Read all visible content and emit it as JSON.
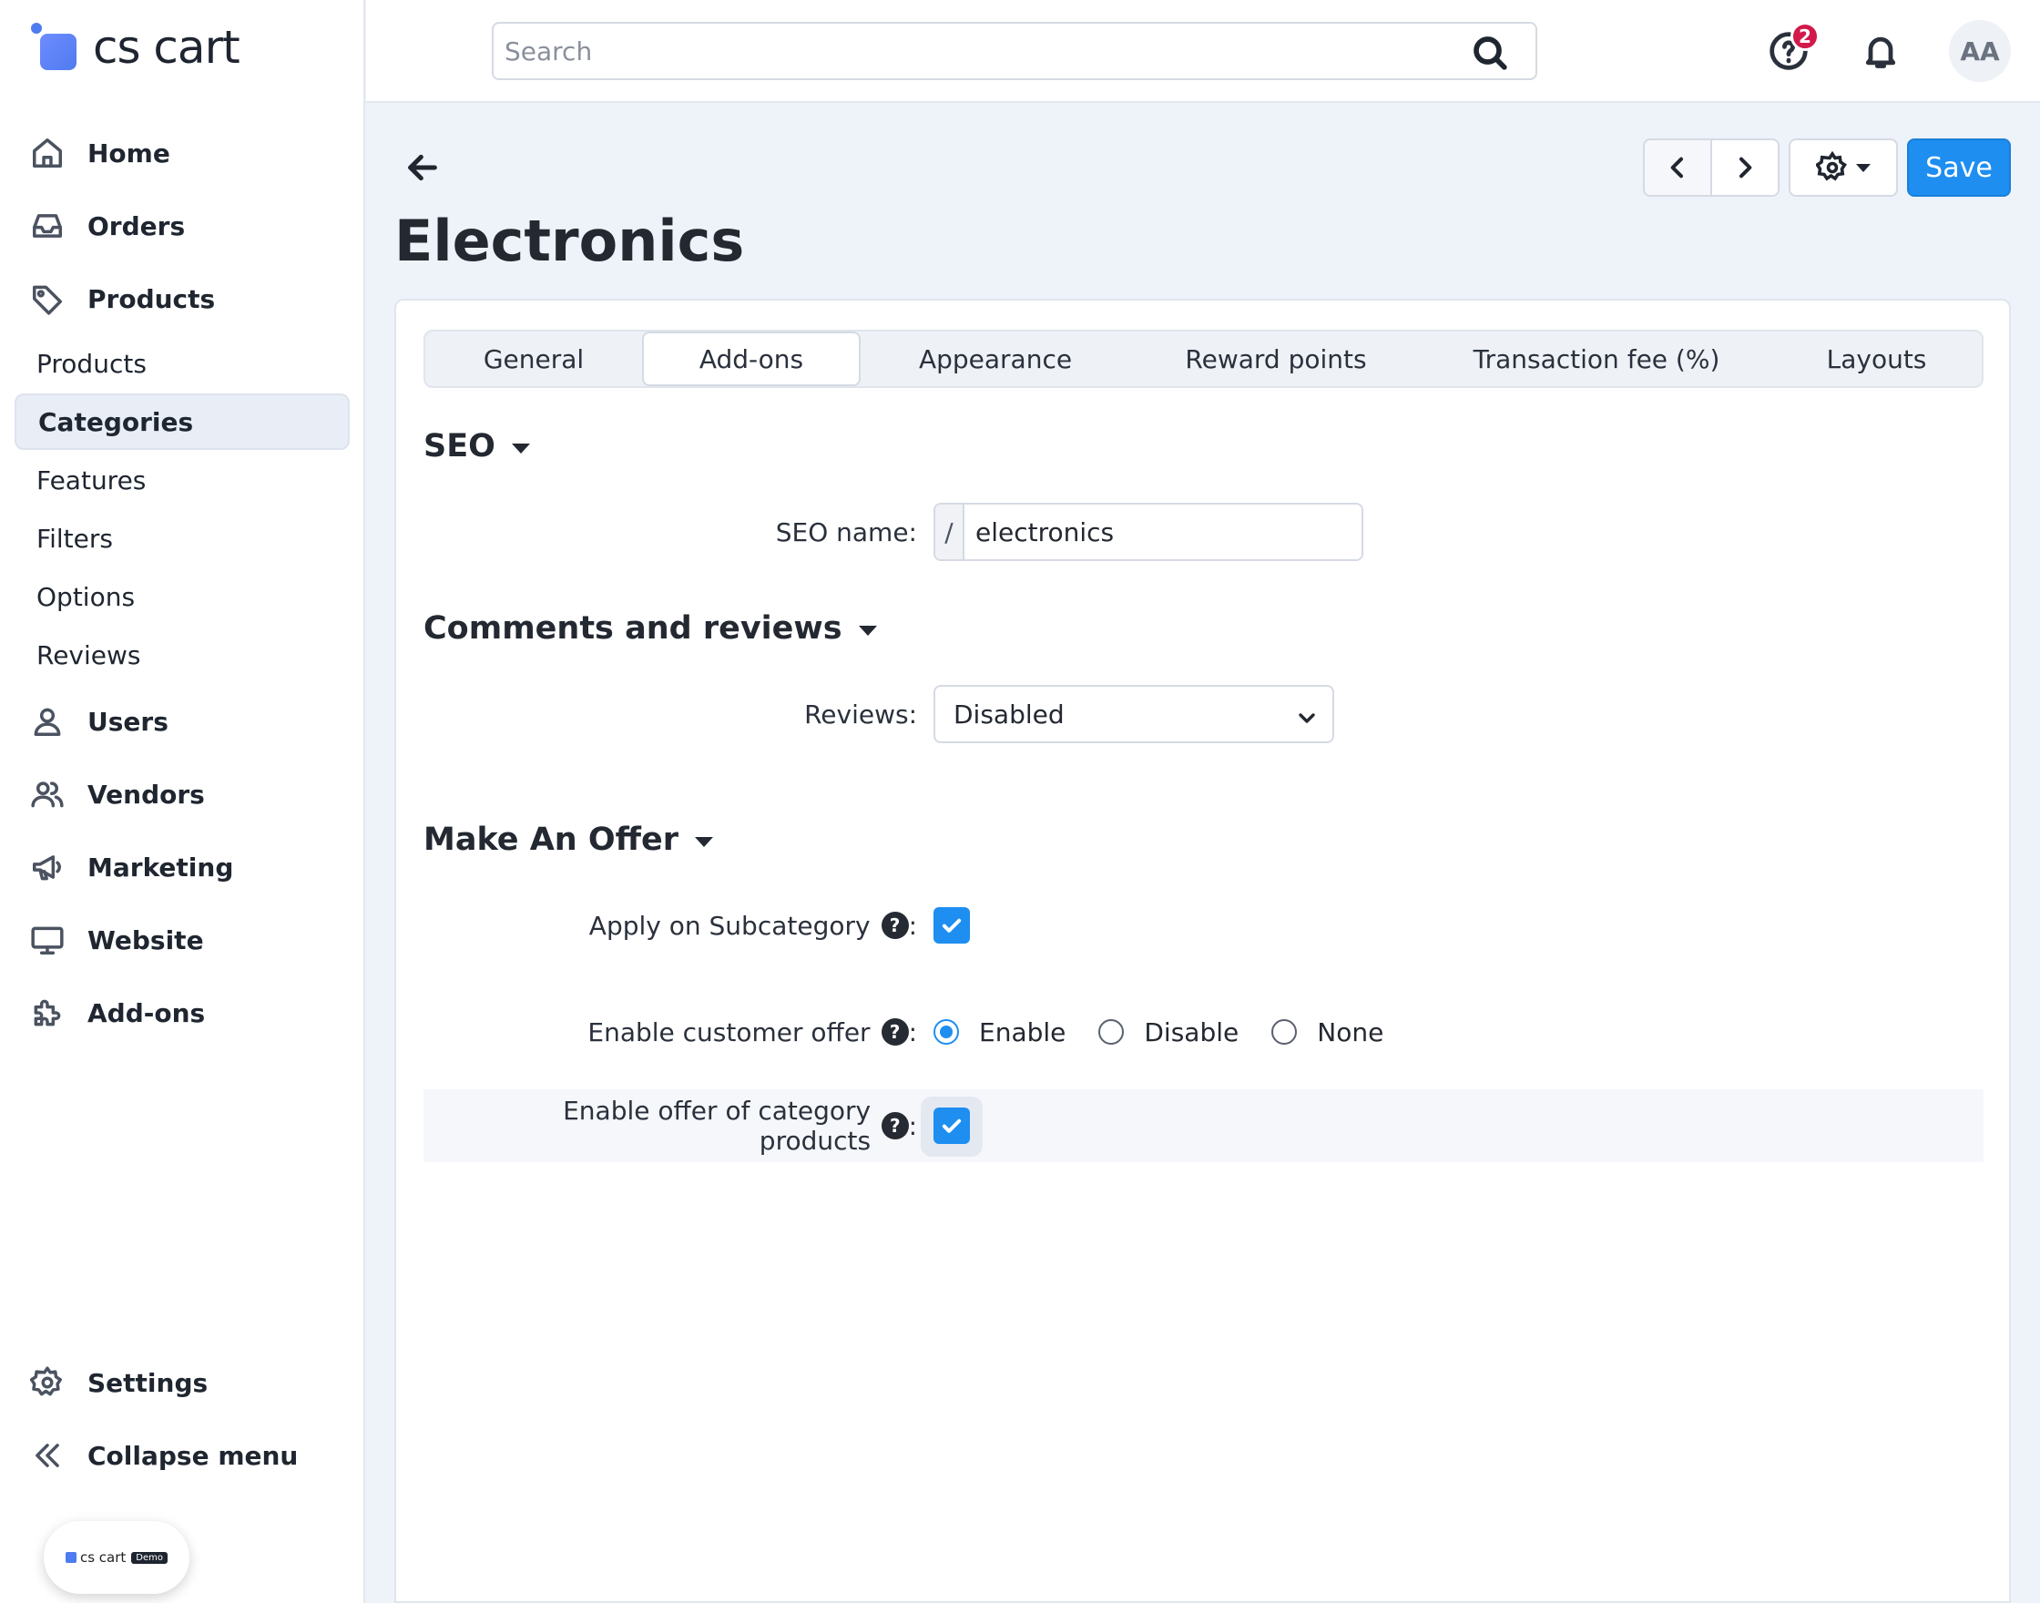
{
  "brand": {
    "name": "cs cart",
    "demo_badge": "cs cart",
    "demo_pill": "Demo"
  },
  "sidebar": {
    "items": [
      {
        "label": "Home",
        "icon": "home-icon"
      },
      {
        "label": "Orders",
        "icon": "inbox-icon"
      },
      {
        "label": "Products",
        "icon": "tag-icon"
      }
    ],
    "products_sub": [
      {
        "label": "Products"
      },
      {
        "label": "Categories",
        "active": true
      },
      {
        "label": "Features"
      },
      {
        "label": "Filters"
      },
      {
        "label": "Options"
      },
      {
        "label": "Reviews"
      }
    ],
    "items_after": [
      {
        "label": "Users",
        "icon": "user-icon"
      },
      {
        "label": "Vendors",
        "icon": "users-icon"
      },
      {
        "label": "Marketing",
        "icon": "megaphone-icon"
      },
      {
        "label": "Website",
        "icon": "monitor-icon"
      },
      {
        "label": "Add-ons",
        "icon": "puzzle-icon"
      }
    ],
    "bottom": [
      {
        "label": "Settings",
        "icon": "gear-icon"
      },
      {
        "label": "Collapse menu",
        "icon": "double-chevron-left-icon"
      }
    ]
  },
  "topbar": {
    "search_placeholder": "Search",
    "help_badge_count": "2",
    "avatar_initials": "AA"
  },
  "header": {
    "title": "Electronics",
    "save_label": "Save"
  },
  "tabs": [
    {
      "label": "General"
    },
    {
      "label": "Add-ons",
      "active": true
    },
    {
      "label": "Appearance"
    },
    {
      "label": "Reward points"
    },
    {
      "label": "Transaction fee (%)"
    },
    {
      "label": "Layouts"
    }
  ],
  "seo": {
    "title": "SEO",
    "name_label": "SEO name:",
    "prefix": "/",
    "name_value": "electronics"
  },
  "comments": {
    "title": "Comments and reviews",
    "reviews_label": "Reviews:",
    "reviews_value": "Disabled"
  },
  "offer": {
    "title": "Make An Offer",
    "apply_label": "Apply on Subcategory",
    "apply_checked": true,
    "customer_offer_label": "Enable customer offer",
    "customer_offer_options": [
      "Enable",
      "Disable",
      "None"
    ],
    "customer_offer_selected": "Enable",
    "category_products_label": "Enable offer of category products",
    "category_products_checked": true,
    "help_glyph": "?",
    "colon": ":"
  },
  "colors": {
    "accent": "#1e8ef0",
    "badge": "#d2194a",
    "sidebar_active": "#e8edf6"
  }
}
